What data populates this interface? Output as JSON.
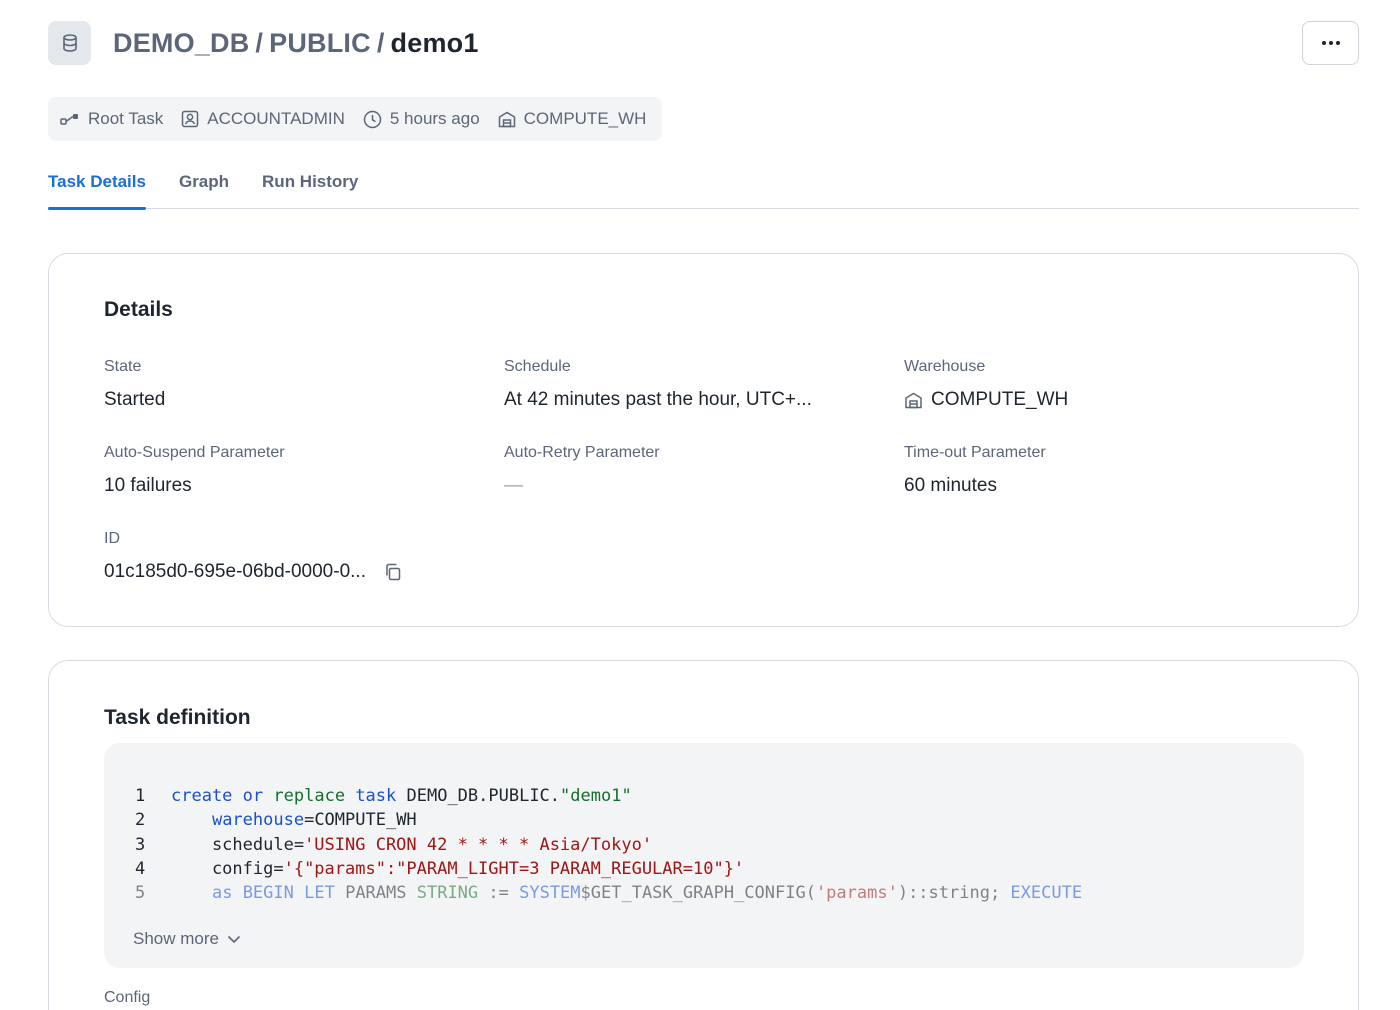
{
  "header": {
    "breadcrumb": [
      "DEMO_DB",
      "PUBLIC",
      "demo1"
    ],
    "separator": "/",
    "db_icon": "database-icon",
    "more_icon": "ellipsis-icon"
  },
  "meta": {
    "task_type": "Root Task",
    "owner": "ACCOUNTADMIN",
    "created": "5 hours ago",
    "warehouse": "COMPUTE_WH"
  },
  "tabs": [
    {
      "label": "Task Details",
      "active": true
    },
    {
      "label": "Graph",
      "active": false
    },
    {
      "label": "Run History",
      "active": false
    }
  ],
  "details": {
    "title": "Details",
    "state_label": "State",
    "state_value": "Started",
    "schedule_label": "Schedule",
    "schedule_value": "At 42 minutes past the hour, UTC+...",
    "warehouse_label": "Warehouse",
    "warehouse_value": "COMPUTE_WH",
    "auto_suspend_label": "Auto-Suspend Parameter",
    "auto_suspend_value": "10 failures",
    "auto_retry_label": "Auto-Retry Parameter",
    "auto_retry_value": "—",
    "timeout_label": "Time-out Parameter",
    "timeout_value": "60 minutes",
    "id_label": "ID",
    "id_value": "01c185d0-695e-06bd-0000-0..."
  },
  "task_definition": {
    "title": "Task definition",
    "lines": [
      {
        "n": "1",
        "tokens": [
          {
            "t": "create",
            "c": "kw-blue"
          },
          {
            "t": " ",
            "c": "plain"
          },
          {
            "t": "or",
            "c": "kw-blue"
          },
          {
            "t": " ",
            "c": "plain"
          },
          {
            "t": "replace",
            "c": "kw-green"
          },
          {
            "t": " ",
            "c": "plain"
          },
          {
            "t": "task",
            "c": "kw-blue"
          },
          {
            "t": " DEMO_DB.PUBLIC.",
            "c": "plain"
          },
          {
            "t": "\"demo1\"",
            "c": "kw-green"
          }
        ]
      },
      {
        "n": "2",
        "tokens": [
          {
            "t": "    ",
            "c": "plain"
          },
          {
            "t": "warehouse",
            "c": "kw-blue"
          },
          {
            "t": "=COMPUTE_WH",
            "c": "plain"
          }
        ]
      },
      {
        "n": "3",
        "tokens": [
          {
            "t": "    schedule=",
            "c": "plain"
          },
          {
            "t": "'USING CRON 42 * * * * Asia/Tokyo'",
            "c": "str"
          }
        ]
      },
      {
        "n": "4",
        "tokens": [
          {
            "t": "    config=",
            "c": "plain"
          },
          {
            "t": "'{\"params\":\"PARAM_LIGHT=3 PARAM_REGULAR=10\"}'",
            "c": "str"
          }
        ]
      },
      {
        "n": "5",
        "tokens": [
          {
            "t": "    ",
            "c": "plain"
          },
          {
            "t": "as",
            "c": "kw-blue"
          },
          {
            "t": " ",
            "c": "plain"
          },
          {
            "t": "BEGIN",
            "c": "kw-blue"
          },
          {
            "t": " ",
            "c": "plain"
          },
          {
            "t": "LET",
            "c": "kw-blue"
          },
          {
            "t": " PARAMS ",
            "c": "plain"
          },
          {
            "t": "STRING",
            "c": "kw-green"
          },
          {
            "t": " := ",
            "c": "plain"
          },
          {
            "t": "SYSTEM",
            "c": "kw-blue"
          },
          {
            "t": "$GET_TASK_GRAPH_CONFIG(",
            "c": "plain"
          },
          {
            "t": "'params'",
            "c": "str"
          },
          {
            "t": ")::string; ",
            "c": "plain"
          },
          {
            "t": "EXECUTE",
            "c": "kw-blue"
          }
        ]
      }
    ],
    "show_more": "Show more",
    "config_label": "Config"
  },
  "colors": {
    "accent": "#1a6ed8",
    "keyword": "#1a4fcf",
    "string": "#a01515"
  }
}
